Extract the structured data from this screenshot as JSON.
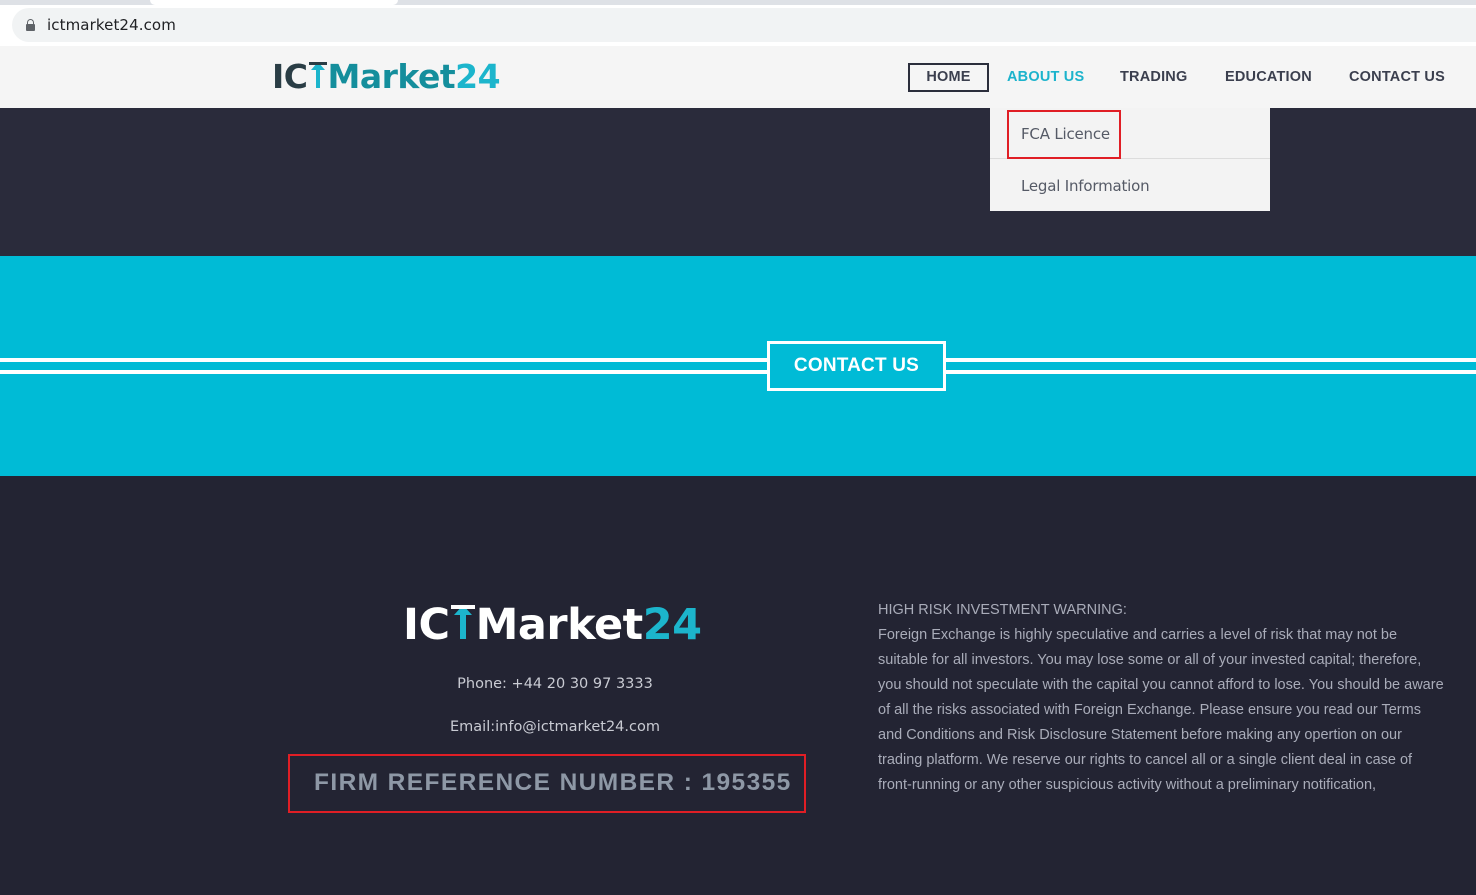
{
  "browser": {
    "url": "ictmarket24.com"
  },
  "header": {
    "logo": {
      "part1": "IC",
      "part2": "Market",
      "part3": "24"
    },
    "nav": {
      "home": "HOME",
      "about": "ABOUT US",
      "trading": "TRADING",
      "education": "EDUCATION",
      "contact": "CONTACT US"
    },
    "dropdown": {
      "fca": "FCA Licence",
      "legal": "Legal Information"
    }
  },
  "band": {
    "contact_label": "CONTACT US"
  },
  "footer": {
    "logo": {
      "part1": "IC",
      "part2": "Market",
      "part3": "24"
    },
    "phone": "Phone:  +44 20 30 97 3333",
    "email": "Email:info@ictmarket24.com",
    "firm_reference": "FIRM REFERENCE NUMBER : 195355",
    "warning_title": "HIGH RISK INVESTMENT WARNING:",
    "warning_text": "Foreign Exchange is highly speculative and carries a level of risk that may not be suitable for all investors. You may lose some or all of your invested capital; therefore, you should not speculate with the capital you cannot afford to lose. You should be aware of all the risks associated with Foreign Exchange. Please ensure you read our Terms and Conditions and Risk Disclosure Statement before making any opertion on our trading platform. We reserve our rights to cancel all or a single client deal in case of front-running or any other suspicious activity without a preliminary notification,"
  },
  "colors": {
    "accent_cyan": "#00bbd6",
    "dark_bg": "#232433",
    "highlight_red": "#e01e25"
  }
}
